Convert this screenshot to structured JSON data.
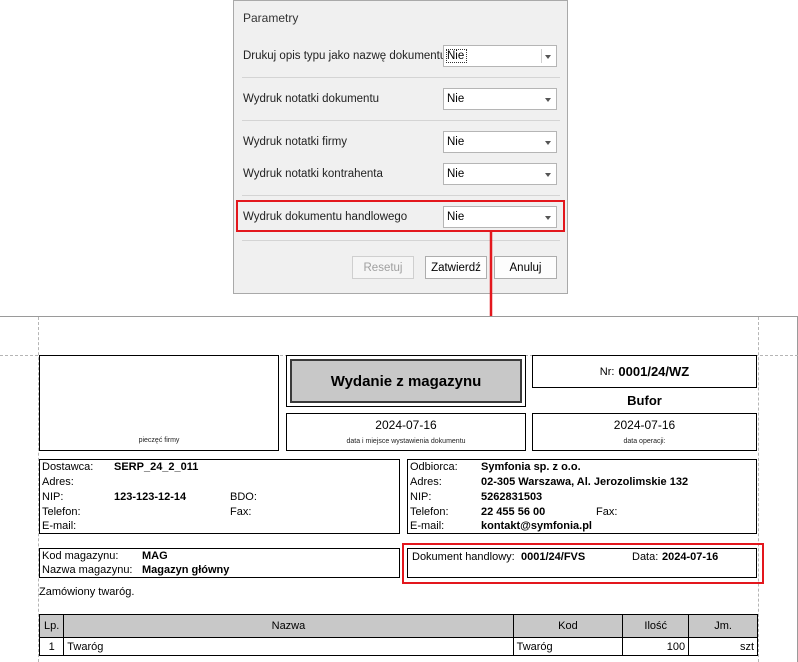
{
  "dialog": {
    "title": "Parametry",
    "params": [
      {
        "label": "Drukuj opis typu jako nazwę dokumentu",
        "value": "Nie"
      },
      {
        "label": "Wydruk notatki dokumentu",
        "value": "Nie"
      },
      {
        "label": "Wydruk notatki firmy",
        "value": "Nie"
      },
      {
        "label": "Wydruk notatki kontrahenta",
        "value": "Nie"
      },
      {
        "label": "Wydruk dokumentu handlowego",
        "value": "Nie"
      }
    ],
    "buttons": {
      "reset": "Resetuj",
      "confirm": "Zatwierdź",
      "cancel": "Anuluj"
    }
  },
  "annotation_color": "#e3171d",
  "doc": {
    "stamp_caption": "pieczęć firmy",
    "title": "Wydanie z magazynu",
    "nr_label": "Nr:",
    "nr_value": "0001/24/WZ",
    "status": "Bufor",
    "issue_date": "2024-07-16",
    "issue_caption": "data i miejsce wystawienia dokumentu",
    "op_date": "2024-07-16",
    "op_caption": "data operacji:",
    "supplier": {
      "label_dostawca": "Dostawca:",
      "dostawca": "SERP_24_2_011",
      "label_adres": "Adres:",
      "label_nip": "NIP:",
      "nip": "123-123-12-14",
      "label_bdo": "BDO:",
      "label_telefon": "Telefon:",
      "label_fax": "Fax:",
      "label_email": "E-mail:"
    },
    "recipient": {
      "label_odbiorca": "Odbiorca:",
      "odbiorca": "Symfonia sp. z o.o.",
      "label_adres": "Adres:",
      "adres": "02-305 Warszawa, Al. Jerozolimskie 132",
      "label_nip": "NIP:",
      "nip": "5262831503",
      "label_telefon": "Telefon:",
      "telefon": "22 455 56 00",
      "label_fax": "Fax:",
      "label_email": "E-mail:",
      "email": "kontakt@symfonia.pl"
    },
    "warehouse": {
      "label_kod": "Kod magazynu:",
      "kod": "MAG",
      "label_nazwa": "Nazwa magazynu:",
      "nazwa": "Magazyn główny"
    },
    "trade_doc": {
      "label": "Dokument handlowy:",
      "value": "0001/24/FVS",
      "date_label": "Data:",
      "date_value": "2024-07-16"
    },
    "note": "Zamówiony twaróg.",
    "table": {
      "headers": [
        "Lp.",
        "Nazwa",
        "Kod",
        "Ilość",
        "Jm."
      ],
      "rows": [
        [
          "1",
          "Twaróg",
          "Twaróg",
          "100",
          "szt"
        ]
      ]
    }
  }
}
